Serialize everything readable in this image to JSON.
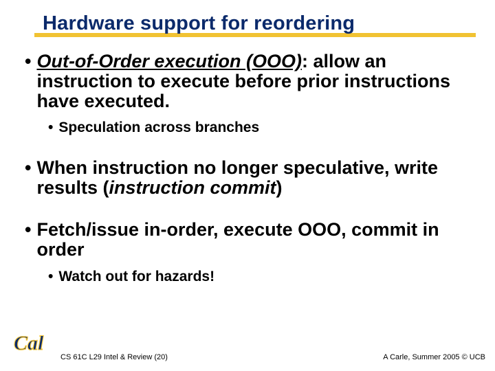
{
  "colors": {
    "title_navy": "#0b2a6b",
    "underline_yellow": "#f1c232",
    "cal_blue": "#0b2a6b",
    "cal_gold": "#f9c838"
  },
  "title": "Hardware support for reordering",
  "bullets": {
    "ooo": {
      "lead_italic_underlined": "Out-of-Order execution (OOO)",
      "rest": ": allow an instruction to execute before prior instructions have executed."
    },
    "speculation": "Speculation across branches",
    "commit": {
      "pre": "When instruction no longer speculative, write results (",
      "ital": "instruction commit",
      "post": ")"
    },
    "inorder": "Fetch/issue in-order, execute OOO, commit in order",
    "hazards": "Watch out for hazards!"
  },
  "footer": {
    "left": "CS 61C L29 Intel & Review (20)",
    "right": "A Carle, Summer 2005 © UCB"
  },
  "logo": {
    "text": "Cal"
  }
}
